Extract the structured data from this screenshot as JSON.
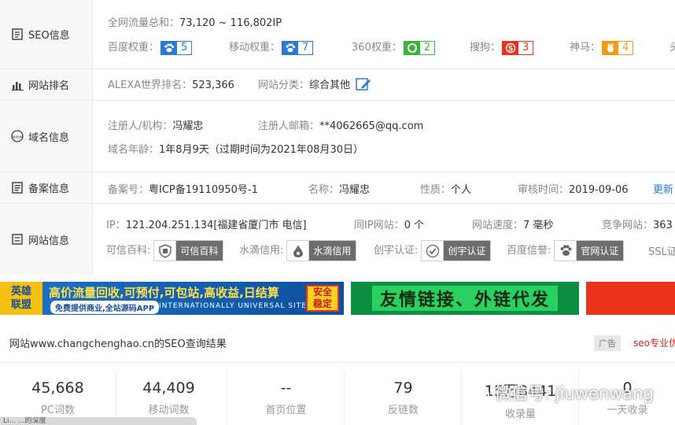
{
  "rows": {
    "seo": {
      "label": "SEO信息",
      "traffic_label": "全网流量总和：",
      "traffic_value": "73,120 ~ 116,802IP",
      "weights": [
        {
          "label": "百度权重：",
          "value": "5",
          "icon": "paw-icon",
          "color": "#2a7ad6"
        },
        {
          "label": "移动权重：",
          "value": "7",
          "icon": "paw-icon",
          "color": "#2a7ad6"
        },
        {
          "label": "360权重：",
          "value": "2",
          "icon": "o-icon",
          "color": "#3bb336"
        },
        {
          "label": "搜狗：",
          "value": "3",
          "icon": "s-icon",
          "color": "#e8321a"
        },
        {
          "label": "神马：",
          "value": "4",
          "icon": "horse-icon",
          "color": "#f39c12"
        }
      ],
      "cut_label": "头"
    },
    "rank": {
      "label": "网站排名",
      "alexa_label": "ALEXA世界排名：",
      "alexa_value": "523,366",
      "category_label": "网站分类：",
      "category_value": "综合其他"
    },
    "domain": {
      "label": "域名信息",
      "registrant_label": "注册人/机构：",
      "registrant_value": "冯耀忠",
      "email_label": "注册人邮箱：",
      "email_value": "**4062665@qq.com",
      "age_label": "域名年龄：",
      "age_value": "1年8月9天（过期时间为2021年08月30日）"
    },
    "icp": {
      "label": "备案信息",
      "number_label": "备案号：",
      "number_value": "粤ICP备19110950号-1",
      "name_label": "名称：",
      "name_value": "冯耀忠",
      "type_label": "性质：",
      "type_value": "个人",
      "review_label": "审核时间：",
      "review_value": "2019-09-06",
      "update_link": "更新"
    },
    "site": {
      "label": "网站信息",
      "ip_label": "IP：",
      "ip_value": "121.204.251.134[福建省厦门市 电信]",
      "sameip_label": "同IP网站：",
      "sameip_value": "0 个",
      "speed_label": "网站速度：",
      "speed_value": "7 毫秒",
      "compete_label": "竞争网站：",
      "compete_value": "363",
      "certs": [
        {
          "label": "可信百科:",
          "badge": "可信百科",
          "icon": "shield-icon"
        },
        {
          "label": "水滴信用:",
          "badge": "水滴信用",
          "icon": "drop-icon"
        },
        {
          "label": "创宇认证:",
          "badge": "创宇认证",
          "icon": "check-shield-icon"
        },
        {
          "label": "百度信誉:",
          "badge": "官网认证",
          "icon": "paw-icon"
        }
      ],
      "ssl_label": "SSL证"
    }
  },
  "banners": {
    "a": {
      "logo_line1": "英雄",
      "logo_line2": "联盟",
      "headline": "高价流量回收,可预付,可包站,高收益,日结算",
      "sub": "免费提供商业,全站源码APP",
      "sub2": "INTERNATIONALLY UNIVERSAL SITE",
      "tag_line1": "安全",
      "tag_line2": "稳定"
    },
    "b": {
      "text": "友情链接、外链代发"
    }
  },
  "result": {
    "title": "网站www.changchenghao.cn的SEO查询结果",
    "ad_label": "广告",
    "promo": "seo专业优"
  },
  "stats": [
    {
      "value": "45,668",
      "caption": "PC词数"
    },
    {
      "value": "44,409",
      "caption": "移动词数"
    },
    {
      "value": "--",
      "caption": "首页位置"
    },
    {
      "value": "79",
      "caption": "反链数"
    },
    {
      "value": "15万8441",
      "caption": "收录量"
    },
    {
      "value": "0",
      "caption": "一天收录"
    }
  ],
  "watermark": {
    "text": "微信号: jiuwenwang"
  },
  "bottom_strip": "Li... ...的深度"
}
